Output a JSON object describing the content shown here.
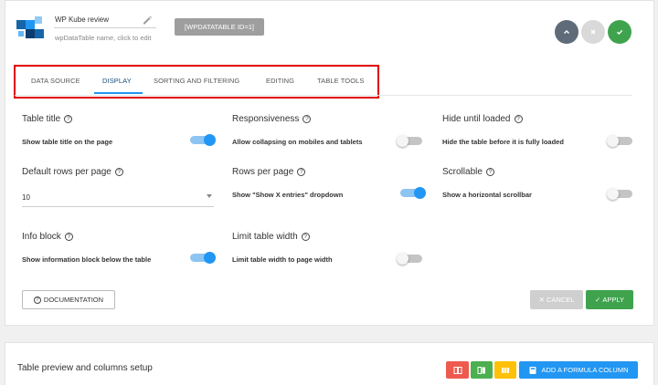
{
  "header": {
    "table_name": "WP Kube review",
    "name_hint": "wpDataTable name, click to edit",
    "shortcode": "[WPDATATABLE ID=1]"
  },
  "tabs": [
    {
      "label": "DATA SOURCE",
      "active": false
    },
    {
      "label": "DISPLAY",
      "active": true
    },
    {
      "label": "SORTING AND FILTERING",
      "active": false
    },
    {
      "label": "EDITING",
      "active": false
    },
    {
      "label": "TABLE TOOLS",
      "active": false
    }
  ],
  "settings": {
    "table_title": {
      "title": "Table title",
      "desc": "Show table title on the page",
      "on": true
    },
    "responsiveness": {
      "title": "Responsiveness",
      "desc": "Allow collapsing on mobiles and tablets",
      "on": false
    },
    "hide_until_loaded": {
      "title": "Hide until loaded",
      "desc": "Hide the table before it is fully loaded",
      "on": false
    },
    "rows_per_page_default": {
      "title": "Default rows per page",
      "value": "10"
    },
    "rows_per_page": {
      "title": "Rows per page",
      "desc": "Show \"Show X entries\" dropdown",
      "on": true
    },
    "scrollable": {
      "title": "Scrollable",
      "desc": "Show a horizontal scrollbar",
      "on": false
    },
    "info_block": {
      "title": "Info block",
      "desc": "Show information block below the table",
      "on": true
    },
    "limit_width": {
      "title": "Limit table width",
      "desc": "Limit table width to page width",
      "on": false
    }
  },
  "buttons": {
    "documentation": "DOCUMENTATION",
    "cancel": "CANCEL",
    "apply": "APPLY"
  },
  "preview": {
    "title": "Table preview and columns setup",
    "add_formula": "ADD A FORMULA COLUMN"
  },
  "colors": {
    "accent": "#2196f3",
    "success": "#3fa34d",
    "danger": "#ef5a4e",
    "warning": "#ffc107",
    "highlight_box": "#e00000"
  }
}
